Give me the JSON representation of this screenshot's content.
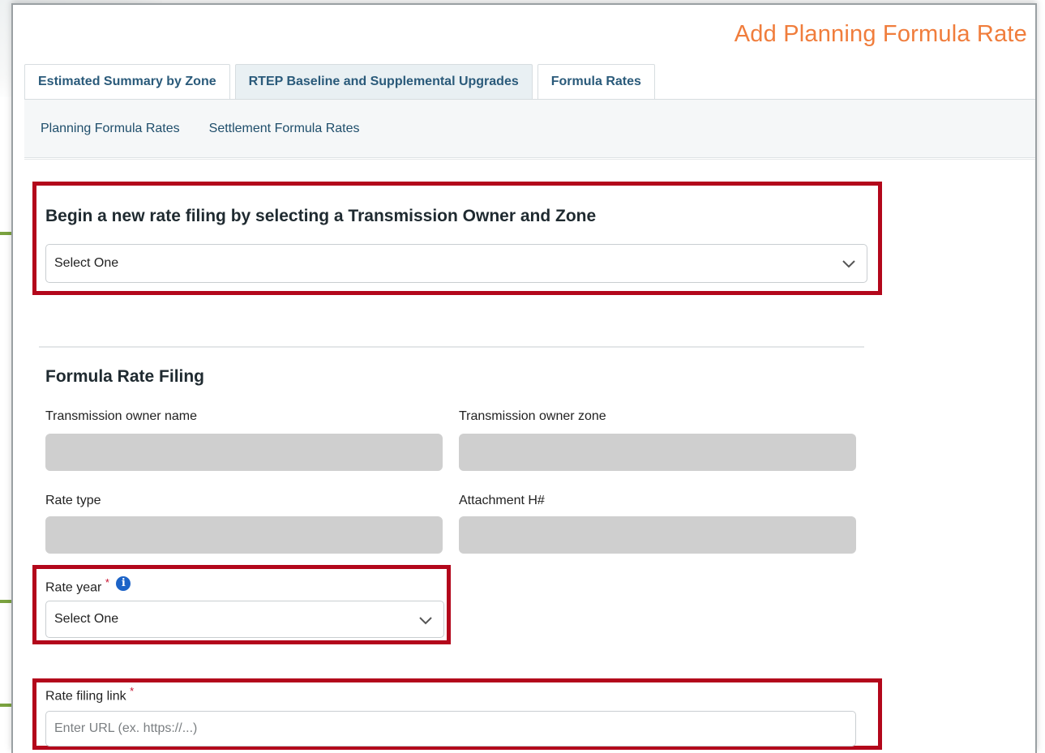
{
  "page": {
    "title": "Add Planning Formula Rate"
  },
  "tabs": [
    {
      "label": "Estimated Summary by Zone"
    },
    {
      "label": "RTEP Baseline and Supplemental Upgrades"
    },
    {
      "label": "Formula Rates"
    }
  ],
  "subnav": [
    {
      "label": "Planning Formula Rates"
    },
    {
      "label": "Settlement Formula Rates"
    }
  ],
  "new_filing": {
    "heading": "Begin a new rate filing by selecting a Transmission Owner and Zone",
    "select_value": "Select One"
  },
  "formula_rate_filing": {
    "heading": "Formula Rate Filing",
    "owner_name_label": "Transmission owner name",
    "owner_zone_label": "Transmission owner zone",
    "rate_type_label": "Rate type",
    "attachment_label": "Attachment H#",
    "rate_year_label": "Rate year",
    "rate_year_required": "*",
    "rate_year_info": "i",
    "rate_year_value": "Select One",
    "rate_filing_link_label": "Rate filing link",
    "rate_filing_link_required": "*",
    "rate_filing_link_placeholder": "Enter URL (ex. https://...)"
  },
  "colors": {
    "title": "#f07d3c",
    "highlight": "#b3071b",
    "callout": "#7aa23f",
    "info": "#1c63c7"
  },
  "icons": {
    "select_arrow": "chevron-down-icon",
    "info": "info-icon"
  }
}
